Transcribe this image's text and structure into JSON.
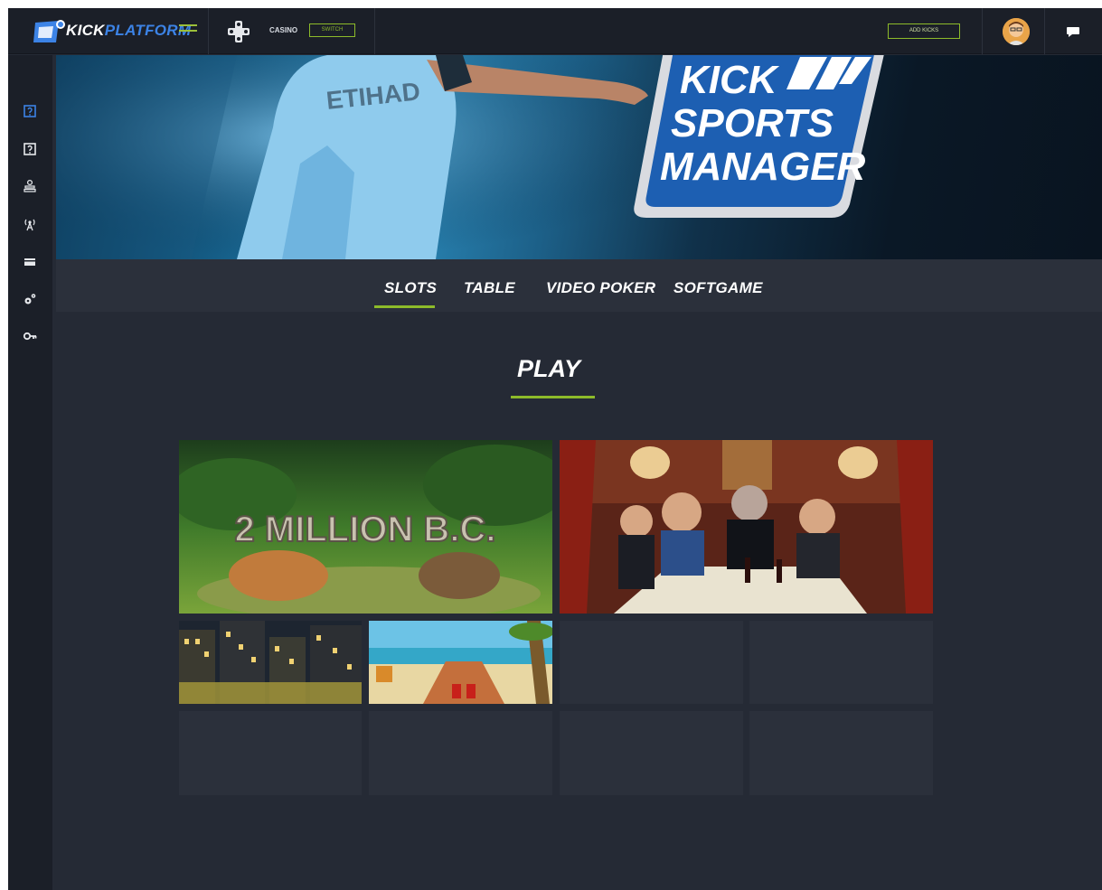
{
  "topbar": {
    "brand_part1": "KICK",
    "brand_part2": "PLATFORM",
    "section_label": "CASINO",
    "switch_label": "SWITCH",
    "add_label": "ADD KICKS",
    "icons": [
      "logo-icon",
      "menu-icon",
      "gamepad-icon",
      "avatar",
      "chat-icon"
    ],
    "accent_color": "#8dbb2a",
    "brand_color": "#3c83e6"
  },
  "sidebar": {
    "items": [
      {
        "icon": "question-icon",
        "active": true
      },
      {
        "icon": "help-icon",
        "active": false
      },
      {
        "icon": "users-icon",
        "active": false
      },
      {
        "icon": "broadcast-icon",
        "active": false
      },
      {
        "icon": "card-icon",
        "active": false
      },
      {
        "icon": "settings-icon",
        "active": false
      },
      {
        "icon": "key-icon",
        "active": false
      }
    ]
  },
  "hero": {
    "logo_lines": [
      "KICK",
      "SPORTS",
      "MANAGER"
    ]
  },
  "tabs": {
    "items": [
      "SLOTS",
      "TABLE",
      "VIDEO POKER",
      "SOFTGAME"
    ],
    "active": "SLOTS"
  },
  "play": {
    "title": "PLAY"
  },
  "games": {
    "featured": [
      {
        "name": "2 MILLION B.C."
      },
      {
        "name": "mafia-table-game"
      }
    ],
    "small": [
      {
        "name": "city-night-game"
      },
      {
        "name": "beach-game"
      }
    ],
    "empty_slots": 6
  }
}
